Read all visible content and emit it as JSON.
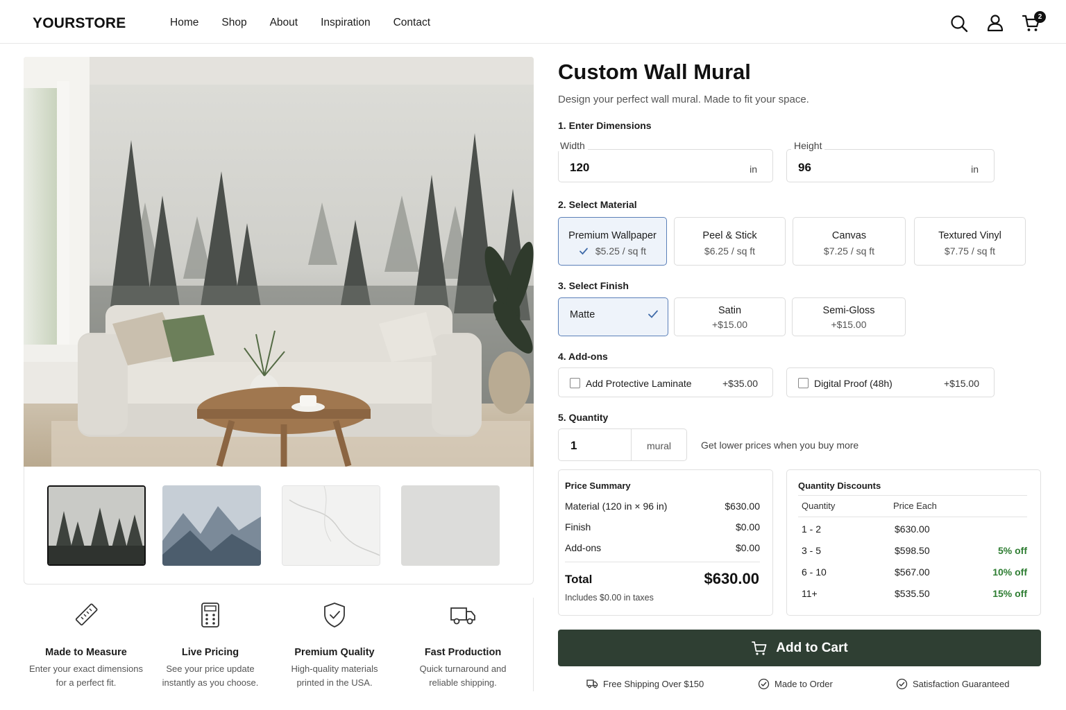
{
  "header": {
    "logo": "YOURSTORE",
    "nav": [
      "Home",
      "Shop",
      "About",
      "Inspiration",
      "Contact"
    ],
    "cart_count": "2",
    "icons": [
      "search-icon",
      "user-icon",
      "cart-icon"
    ]
  },
  "product": {
    "title": "Custom Wall Mural",
    "subtitle": "Design your perfect wall mural. Made to fit your space."
  },
  "steps": {
    "dimensions": "1. Enter Dimensions",
    "material": "2. Select Material",
    "finish": "3. Select Finish",
    "addons": "4. Add-ons",
    "quantity": "5. Quantity"
  },
  "dimensions": {
    "width_label": "Width",
    "width_value": "120",
    "height_label": "Height",
    "height_value": "96",
    "unit": "in"
  },
  "materials": [
    {
      "name": "Premium Wallpaper",
      "price": "$5.25 / sq ft",
      "selected": true
    },
    {
      "name": "Peel & Stick",
      "price": "$6.25 / sq ft",
      "selected": false
    },
    {
      "name": "Canvas",
      "price": "$7.25 / sq ft",
      "selected": false
    },
    {
      "name": "Textured Vinyl",
      "price": "$7.75 / sq ft",
      "selected": false
    }
  ],
  "finishes": [
    {
      "name": "Matte",
      "price": "",
      "selected": true
    },
    {
      "name": "Satin",
      "price": "+$15.00",
      "selected": false
    },
    {
      "name": "Semi-Gloss",
      "price": "+$15.00",
      "selected": false
    }
  ],
  "addons": [
    {
      "label": "Add Protective Laminate",
      "price": "+$35.00",
      "checked": false
    },
    {
      "label": "Digital Proof (48h)",
      "price": "+$15.00",
      "checked": false
    }
  ],
  "quantity": {
    "value": "1",
    "unit": "mural",
    "hint": "Get lower prices when you buy more"
  },
  "price_summary": {
    "title": "Price Summary",
    "rows": [
      {
        "label": "Material (120 in × 96 in)",
        "value": "$630.00"
      },
      {
        "label": "Finish",
        "value": "$0.00"
      },
      {
        "label": "Add-ons",
        "value": "$0.00"
      }
    ],
    "total_label": "Total",
    "total_value": "$630.00",
    "tax_note": "Includes $0.00 in taxes"
  },
  "quantity_discounts": {
    "title": "Quantity Discounts",
    "headers": [
      "Quantity",
      "Price Each"
    ],
    "rows": [
      {
        "qty": "1 - 2",
        "price": "$630.00",
        "off": ""
      },
      {
        "qty": "3 - 5",
        "price": "$598.50",
        "off": "5% off"
      },
      {
        "qty": "6 - 10",
        "price": "$567.00",
        "off": "10% off"
      },
      {
        "qty": "11+",
        "price": "$535.50",
        "off": "15% off"
      }
    ]
  },
  "cta": {
    "label": "Add to Cart"
  },
  "trust": [
    {
      "label": "Free Shipping Over $150",
      "icon": "truck-icon"
    },
    {
      "label": "Made to Order",
      "icon": "badge-check-icon"
    },
    {
      "label": "Satisfaction Guaranteed",
      "icon": "check-circle-icon"
    }
  ],
  "features": [
    {
      "title": "Made to Measure",
      "desc1": "Enter your exact dimensions",
      "desc2": "for a perfect fit.",
      "icon": "ruler-icon"
    },
    {
      "title": "Live Pricing",
      "desc1": "See your price update",
      "desc2": "instantly as you choose.",
      "icon": "calculator-icon"
    },
    {
      "title": "Premium Quality",
      "desc1": "High-quality materials",
      "desc2": "printed in the USA.",
      "icon": "shield-check-icon"
    },
    {
      "title": "Fast Production",
      "desc1": "Quick turnaround and",
      "desc2": "reliable shipping.",
      "icon": "truck-icon"
    }
  ],
  "colors": {
    "accent": "#2f3f33",
    "selected_border": "#5a7fb8",
    "selected_bg": "#eef3fa",
    "discount_green": "#2e7d32"
  }
}
